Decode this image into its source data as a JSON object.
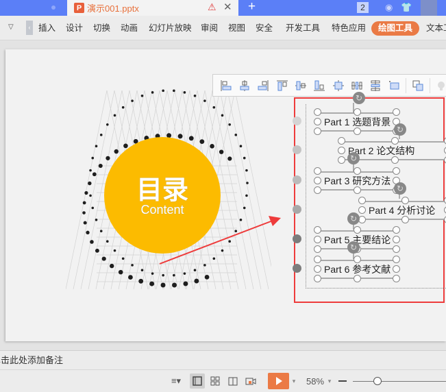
{
  "titlebar": {
    "document_tab": "演示001.pptx",
    "doc_icon_letter": "P",
    "window_count": "2",
    "warning_icon": "⚠",
    "close_glyph": "✕",
    "new_tab_glyph": "+"
  },
  "ribbon": {
    "menus": [
      "插入",
      "设计",
      "切换",
      "动画",
      "幻灯片放映",
      "审阅",
      "视图",
      "安全",
      "开发工具",
      "特色应用",
      "绘图工具",
      "文本工具"
    ],
    "active_menu": "绘图工具"
  },
  "slide": {
    "circle_title": "目录",
    "circle_subtitle": "Content",
    "accent_color": "#fcbb00",
    "selection_color": "#ee3b3b",
    "items": [
      {
        "part": "Part 1",
        "title": "选题背景"
      },
      {
        "part": "Part 2",
        "title": "论文结构"
      },
      {
        "part": "Part 3",
        "title": "研究方法"
      },
      {
        "part": "Part 4",
        "title": "分析讨论"
      },
      {
        "part": "Part 5",
        "title": "主要结论"
      },
      {
        "part": "Part 6",
        "title": "参考文献"
      }
    ]
  },
  "align_toolbar": {
    "buttons": [
      "align-left",
      "align-center",
      "align-right",
      "align-top",
      "align-middle",
      "align-bottom",
      "align-center-both",
      "distribute-horizontal",
      "distribute-vertical",
      "fit-canvas",
      "group",
      "more"
    ]
  },
  "notes": {
    "placeholder": "单击此处添加备注"
  },
  "statusbar": {
    "zoom": "58%"
  }
}
